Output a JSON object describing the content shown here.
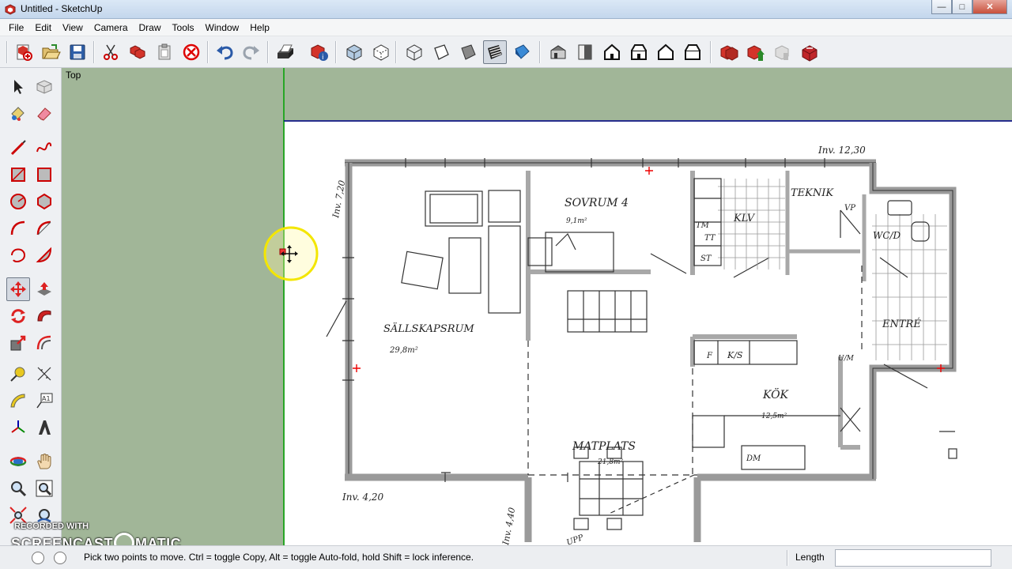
{
  "window": {
    "title": "Untitled - SketchUp",
    "minimize": "—",
    "maximize": "□",
    "close": "✕"
  },
  "menu": [
    "File",
    "Edit",
    "View",
    "Camera",
    "Draw",
    "Tools",
    "Window",
    "Help"
  ],
  "toolbar_icons": [
    "new-icon",
    "open-icon",
    "save-icon",
    "cut-icon",
    "copy-icon",
    "paste-icon",
    "erase-icon",
    "undo-icon",
    "redo-icon",
    "print-icon",
    "model-info-icon",
    "xray-icon",
    "back-edges-icon",
    "wireframe-icon",
    "hidden-line-icon",
    "shaded-icon",
    "shaded-textures-icon",
    "monochrome-icon",
    "iso-view-icon",
    "top-view-icon",
    "front-view-icon",
    "right-view-icon",
    "back-view-icon",
    "left-view-icon",
    "get-models-icon",
    "share-model-icon",
    "share-component-icon",
    "extension-warehouse-icon"
  ],
  "palette_icons": [
    "select-icon",
    "make-component-icon",
    "paint-bucket-icon",
    "eraser-icon",
    "line-icon",
    "freehand-icon",
    "rectangle-icon",
    "rotated-rectangle-icon",
    "circle-icon",
    "polygon-icon",
    "arc-icon",
    "two-point-arc-icon",
    "three-point-arc-icon",
    "pie-icon",
    "move-icon",
    "push-pull-icon",
    "rotate-icon",
    "follow-me-icon",
    "scale-icon",
    "offset-icon",
    "tape-measure-icon",
    "dimension-icon",
    "protractor-icon",
    "text-icon",
    "axes-icon",
    "3d-text-icon",
    "orbit-icon",
    "pan-icon",
    "zoom-icon",
    "zoom-window-icon",
    "zoom-extents-icon",
    "previous-view-icon"
  ],
  "viewport": {
    "view_name": "Top",
    "plan_labels": {
      "inv_top_right": "Inv. 12,30",
      "inv_left": "Inv. 7,20",
      "inv_bottom_left": "Inv. 4,20",
      "inv_bottom": "Inv. 4,40",
      "sovrum": "SOVRUM 4",
      "sovrum_area": "9,1m²",
      "teknik": "TEKNIK",
      "klv": "KLV",
      "vp": "VP",
      "tm": "TM",
      "tt": "TT",
      "st": "ST",
      "wcd": "WC/D",
      "entre": "ENTRÉ",
      "sallskapsrum": "SÄLLSKAPSRUM",
      "sallskapsrum_area": "29,8m²",
      "f": "F",
      "ks": "K/S",
      "ulm": "U/M",
      "kok": "KÖK",
      "kok_area": "12,5m²",
      "matplats": "MATPLATS",
      "matplats_area": "21,8m²",
      "dm": "DM",
      "upp": "UPP"
    }
  },
  "watermark": {
    "line1": "RECORDED WITH",
    "line2a": "SCREENCAST",
    "line2b": "MATIC"
  },
  "status": {
    "prompt": "Pick two points to move.  Ctrl = toggle Copy, Alt = toggle Auto-fold, hold Shift = lock inference.",
    "vcb_label": "Length",
    "vcb_value": ""
  },
  "colors": {
    "viewport_bg": "#a1b698",
    "axis_green": "#00a000",
    "axis_blue": "#00008b",
    "cursor_ring": "#f3e600"
  }
}
